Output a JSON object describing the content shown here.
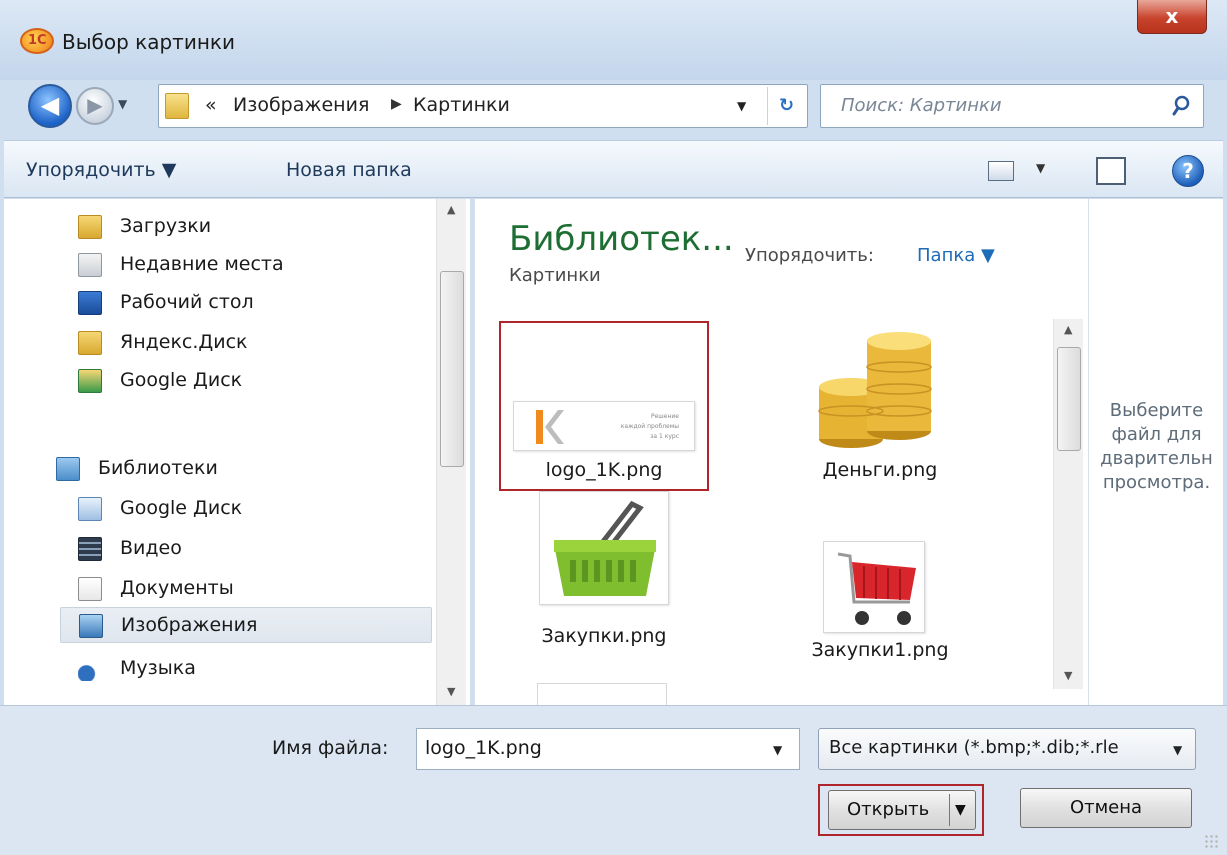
{
  "window": {
    "title": "Выбор картинки",
    "app_icon_text": "1С",
    "close_symbol": "x"
  },
  "navigation": {
    "back_symbol": "◀",
    "forward_symbol": "▶",
    "address": {
      "prefix": "«",
      "crumbs": [
        "Изображения",
        "Картинки"
      ],
      "separator": "▶"
    },
    "refresh_symbol": "↻",
    "search_placeholder": "Поиск: Картинки"
  },
  "toolbar": {
    "organize_label": "Упорядочить ▼",
    "new_folder_label": "Новая папка",
    "help_symbol": "?"
  },
  "nav_pane": {
    "items": [
      {
        "label": "Загрузки",
        "icon": "downloads-folder-icon"
      },
      {
        "label": "Недавние места",
        "icon": "recent-places-icon"
      },
      {
        "label": "Рабочий стол",
        "icon": "desktop-icon"
      },
      {
        "label": "Яндекс.Диск",
        "icon": "yandex-disk-folder-icon"
      },
      {
        "label": "Google Диск",
        "icon": "google-drive-folder-icon"
      }
    ],
    "libraries": {
      "label": "Библиотеки",
      "icon": "libraries-icon"
    },
    "library_items": [
      {
        "label": "Google Диск",
        "icon": "google-drive-library-icon"
      },
      {
        "label": "Видео",
        "icon": "video-library-icon"
      },
      {
        "label": "Документы",
        "icon": "documents-library-icon"
      },
      {
        "label": "Изображения",
        "icon": "pictures-library-icon",
        "selected": true
      },
      {
        "label": "Музыка",
        "icon": "music-library-icon"
      }
    ]
  },
  "content": {
    "library_title": "Библиотек...",
    "library_subtitle": "Картинки",
    "arrange_label": "Упорядочить:",
    "arrange_value": "Папка ▼",
    "files": [
      {
        "name": "logo_1K.png",
        "thumb": "logo-1k-thumbnail",
        "selected": true,
        "thumb_text": [
          "Решение",
          "каждой проблемы",
          "за 1 курс"
        ]
      },
      {
        "name": "Деньги.png",
        "thumb": "coins-thumbnail"
      },
      {
        "name": "Закупки.png",
        "thumb": "green-basket-thumbnail"
      },
      {
        "name": "Закупки1.png",
        "thumb": "red-cart-thumbnail"
      }
    ]
  },
  "preview_pane": {
    "message": "Выберите\nфайл для\nдварительн\nпросмотра."
  },
  "bottom": {
    "filename_label": "Имя файла:",
    "filename_value": "logo_1K.png",
    "filter_value": "Все картинки (*.bmp;*.dib;*.rle",
    "open_label": "Открыть",
    "cancel_label": "Отмена"
  },
  "colors": {
    "selection_highlight": "#b0242c",
    "library_title": "#1e6e33",
    "link_blue": "#1e6bb8"
  }
}
